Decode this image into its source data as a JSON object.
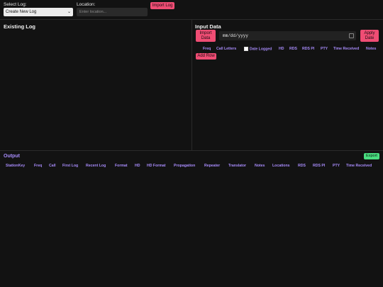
{
  "topbar": {
    "select_log_label": "Select Log:",
    "select_log_value": "Create New Log",
    "location_label": "Location:",
    "location_placeholder": "Enter location...",
    "import_log_label": "Import Log"
  },
  "existing_log": {
    "title": "Existing Log"
  },
  "input_data": {
    "title": "Input Data",
    "import_data_label": [
      "Import",
      "Data"
    ],
    "date_placeholder": "mm/dd/yyyy",
    "apply_date_label": [
      "Apply",
      "Date"
    ],
    "columns": [
      "Freq",
      "Call Letters",
      "Date Logged",
      "HD",
      "RDS",
      "RDS PI",
      "PTY",
      "Time Received",
      "Notes"
    ],
    "add_row_label": "Add Row"
  },
  "output": {
    "title": "Output",
    "export_label": "Export",
    "columns": [
      "StationKey",
      "Freq",
      "Call",
      "First Log",
      "Recent Log",
      "Format",
      "HD",
      "HD Format",
      "Propagation",
      "Repeater",
      "Translator",
      "Notes",
      "Locations",
      "RDS",
      "RDS PI",
      "PTY",
      "Time Received"
    ]
  },
  "colors": {
    "accent_pink": "#ef4d74",
    "accent_purple": "#a78bfa",
    "accent_green": "#4ade80",
    "background": "#121212"
  }
}
